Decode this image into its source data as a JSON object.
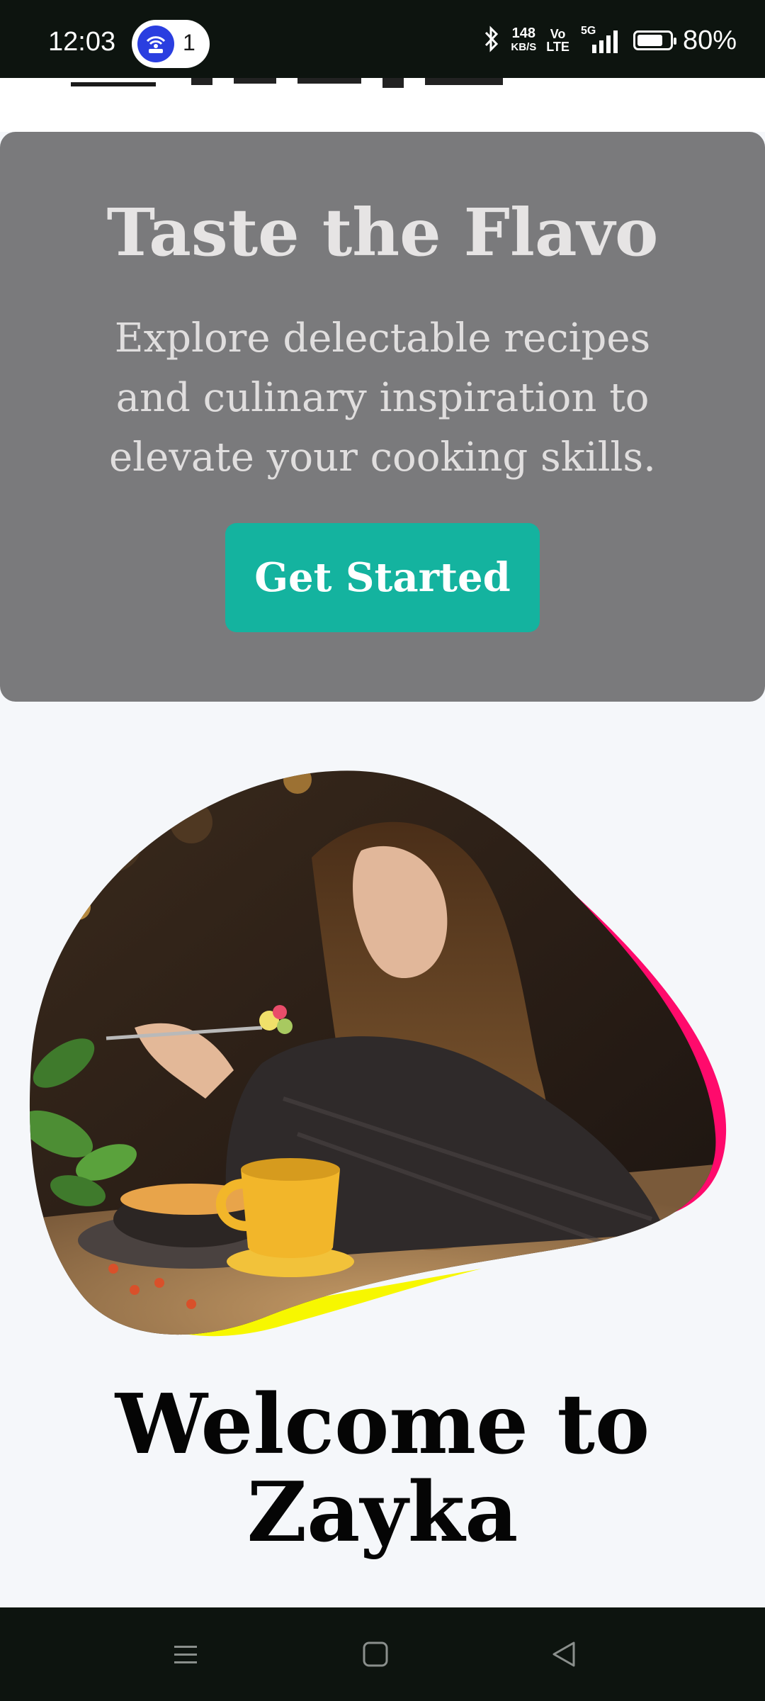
{
  "status_bar": {
    "time": "12:03",
    "hotspot_count": "1",
    "net_speed_value": "148",
    "net_speed_unit": "KB/S",
    "volte_top": "Vo",
    "volte_bottom": "LTE",
    "network": "5G",
    "battery_percent": "80%",
    "battery_level": 0.8
  },
  "hero": {
    "title": "Taste the Flavo",
    "subtitle": "Explore delectable recipes and culinary inspiration to elevate your cooking skills.",
    "cta_label": "Get Started"
  },
  "welcome": {
    "line1": "Welcome to",
    "line2": "Zayka"
  },
  "colors": {
    "accent": "#14b39f",
    "hero_bg": "#7a7a7c",
    "blob_pink": "#ff0a6c",
    "blob_yellow": "#f7f700"
  },
  "icons": {
    "hotspot": "hotspot-icon",
    "bluetooth": "bluetooth-icon",
    "signal": "signal-icon",
    "battery": "battery-icon",
    "menu": "menu-icon",
    "home": "home-icon",
    "back": "back-icon"
  }
}
